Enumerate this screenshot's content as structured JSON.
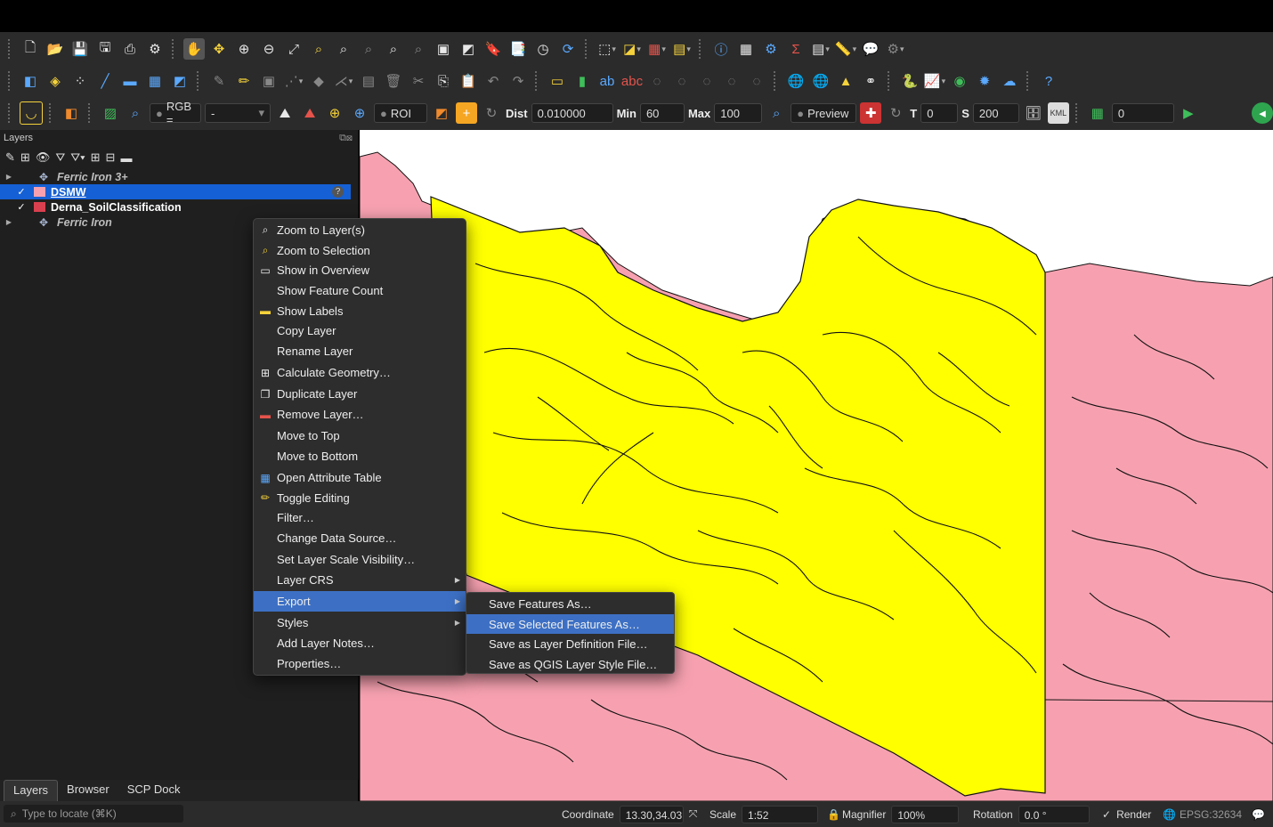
{
  "toolbar3": {
    "band_mode": "RGB =",
    "band_value": "-",
    "roi_label": "ROI",
    "dist_label": "Dist",
    "dist_value": "0.010000",
    "min_label": "Min",
    "min_value": "60",
    "max_label": "Max",
    "max_value": "100",
    "preview_label": "Preview",
    "t_label": "T",
    "t_value": "0",
    "s_label": "S",
    "s_value": "200",
    "kml_label": "KML",
    "count_value": "0"
  },
  "layers_panel": {
    "title": "Layers",
    "layers": [
      {
        "name": "Ferric Iron 3+",
        "type": "raster",
        "checked": false,
        "expandable": true
      },
      {
        "name": "DSMW",
        "type": "vector",
        "checked": true,
        "selected": true,
        "color": "#f7a1b0"
      },
      {
        "name": "Derna_SoilClassification",
        "type": "vector",
        "checked": true,
        "color": "#d9404f"
      },
      {
        "name": "Ferric Iron",
        "type": "raster",
        "checked": false,
        "expandable": true
      }
    ],
    "check_mark": "✓",
    "help_mark": "?"
  },
  "bottom_tabs": [
    "Layers",
    "Browser",
    "SCP Dock"
  ],
  "context_menu": {
    "items": [
      {
        "label": "Zoom to Layer(s)",
        "icon": "zoom-layer-icon"
      },
      {
        "label": "Zoom to Selection",
        "icon": "zoom-selection-icon"
      },
      {
        "label": "Show in Overview",
        "icon": "overview-icon"
      },
      {
        "label": "Show Feature Count",
        "icon": ""
      },
      {
        "label": "Show Labels",
        "icon": "labels-icon"
      },
      {
        "label": "Copy Layer",
        "icon": ""
      },
      {
        "label": "Rename Layer",
        "icon": ""
      },
      {
        "label": "Calculate Geometry…",
        "icon": "calculate-icon"
      },
      {
        "label": "Duplicate Layer",
        "icon": "duplicate-icon"
      },
      {
        "label": "Remove Layer…",
        "icon": "remove-icon"
      },
      {
        "label": "Move to Top",
        "icon": ""
      },
      {
        "label": "Move to Bottom",
        "icon": ""
      },
      {
        "label": "Open Attribute Table",
        "icon": "table-icon"
      },
      {
        "label": "Toggle Editing",
        "icon": "pencil-icon"
      },
      {
        "label": "Filter…",
        "icon": ""
      },
      {
        "label": "Change Data Source…",
        "icon": ""
      },
      {
        "label": "Set Layer Scale Visibility…",
        "icon": ""
      },
      {
        "label": "Layer CRS",
        "icon": "",
        "submenu": true
      },
      {
        "label": "Export",
        "icon": "",
        "submenu": true,
        "highlighted": true
      },
      {
        "label": "Styles",
        "icon": "",
        "submenu": true
      },
      {
        "label": "Add Layer Notes…",
        "icon": ""
      },
      {
        "label": "Properties…",
        "icon": ""
      }
    ]
  },
  "export_submenu": {
    "items": [
      {
        "label": "Save Features As…"
      },
      {
        "label": "Save Selected Features As…",
        "highlighted": true
      },
      {
        "label": "Save as Layer Definition File…"
      },
      {
        "label": "Save as QGIS Layer Style File…"
      }
    ]
  },
  "status_bar": {
    "locate_placeholder": "Type to locate (⌘K)",
    "coordinate_label": "Coordinate",
    "coordinate_value": "13.30,34.03",
    "scale_label": "Scale",
    "scale_value": "1:52",
    "magnifier_label": "Magnifier",
    "magnifier_value": "100%",
    "rotation_label": "Rotation",
    "rotation_value": "0.0 °",
    "render_label": "Render",
    "crs_label": "EPSG:32634"
  },
  "map_colors": {
    "yellow": "#ffff00",
    "pink": "#f7a1b0",
    "background": "#ffffff"
  }
}
